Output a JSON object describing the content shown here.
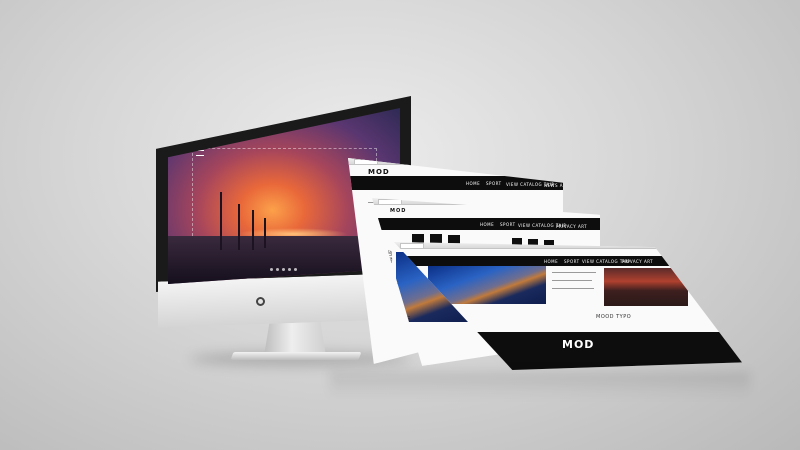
{
  "scene": {
    "background_color": "#cfcfcf"
  },
  "imac": {
    "screen": {
      "tagline": "",
      "dots_count_hint": 5,
      "colors": {
        "sky_top": "#2e2a55",
        "sky_glow": "#fca14a"
      }
    }
  },
  "sheet_back": {
    "logo": "MOD",
    "nav": [
      "HOME",
      "SPORT",
      "VIEW CATALOG TAIP",
      "NEWS ART"
    ]
  },
  "sheet_middle": {
    "logo": "MOD",
    "nav": [
      "HOME",
      "SPORT",
      "VIEW CATALOG TAIP",
      "PRIVACY ART"
    ],
    "vertical_text": [
      "台灣",
      "旅遊",
      "行"
    ]
  },
  "sheet_front": {
    "nav": [
      "HOME",
      "SPORT",
      "VIEW CATALOG TAIP",
      "PRIVACY ART"
    ],
    "section_title": "MOOD  TYPO",
    "brand": "MOD",
    "footer_line": "",
    "colors": {
      "strip": "#0d0d0d",
      "photo_blue": "#2a63c4",
      "photo_red": "#b0412f"
    }
  }
}
